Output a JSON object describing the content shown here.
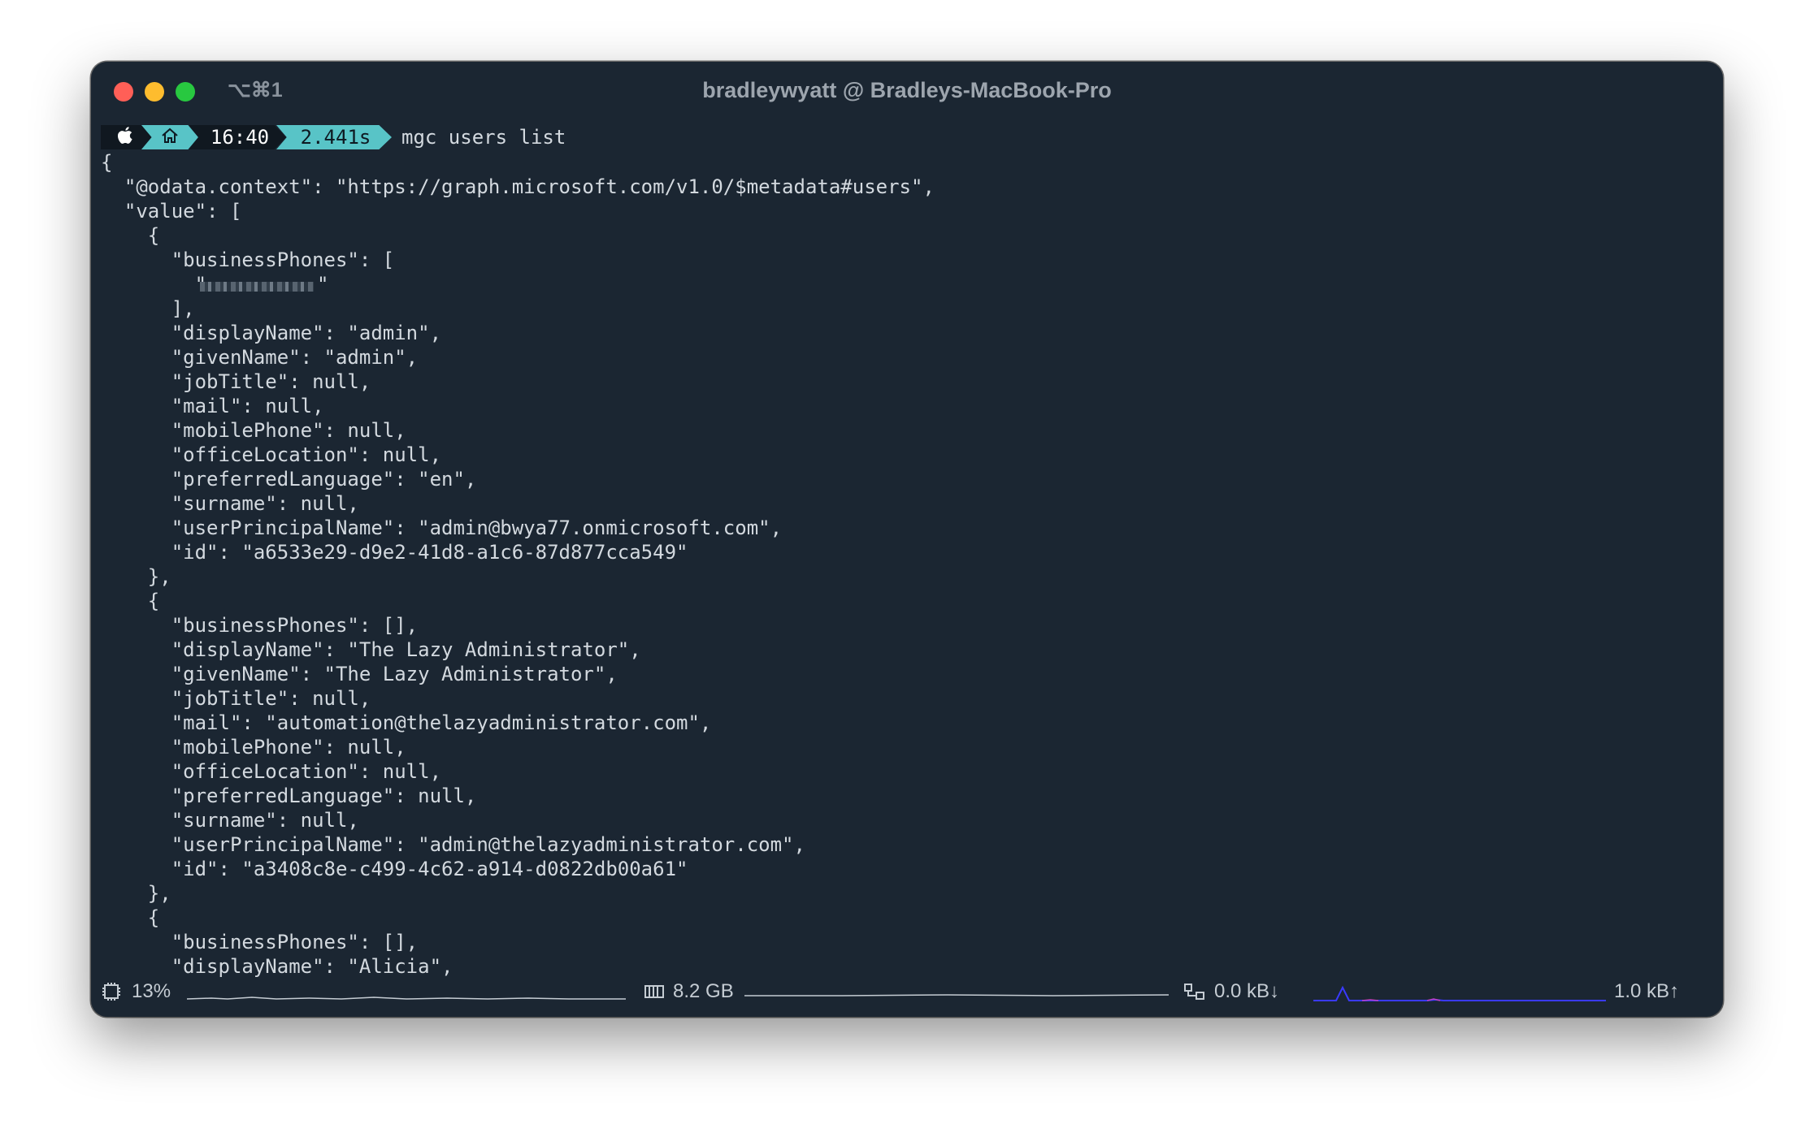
{
  "window": {
    "title": "bradleywyatt @ Bradleys-MacBook-Pro",
    "shortcut": "⌥⌘1",
    "traffic_lights": {
      "close_color": "#ff5f57",
      "minimize_color": "#febc2e",
      "zoom_color": "#28c840"
    }
  },
  "prompt": {
    "apple_icon": "apple-icon",
    "home_icon": "home-icon",
    "time": "16:40",
    "duration": "2.441s",
    "command": "mgc users list",
    "accent_color": "#58c4c7"
  },
  "output": {
    "lines": [
      "{",
      "  \"@odata.context\": \"https://graph.microsoft.com/v1.0/$metadata#users\",",
      "  \"value\": [",
      "    {",
      "      \"businessPhones\": [",
      "        \"",
      "      ],",
      "      \"displayName\": \"admin\",",
      "      \"givenName\": \"admin\",",
      "      \"jobTitle\": null,",
      "      \"mail\": null,",
      "      \"mobilePhone\": null,",
      "      \"officeLocation\": null,",
      "      \"preferredLanguage\": \"en\",",
      "      \"surname\": null,",
      "      \"userPrincipalName\": \"admin@bwya77.onmicrosoft.com\",",
      "      \"id\": \"a6533e29-d9e2-41d8-a1c6-87d877cca549\"",
      "    },",
      "    {",
      "      \"businessPhones\": [],",
      "      \"displayName\": \"The Lazy Administrator\",",
      "      \"givenName\": \"The Lazy Administrator\",",
      "      \"jobTitle\": null,",
      "      \"mail\": \"automation@thelazyadministrator.com\",",
      "      \"mobilePhone\": null,",
      "      \"officeLocation\": null,",
      "      \"preferredLanguage\": null,",
      "      \"surname\": null,",
      "      \"userPrincipalName\": \"admin@thelazyadministrator.com\",",
      "      \"id\": \"a3408c8e-c499-4c62-a914-d0822db00a61\"",
      "    },",
      "    {",
      "      \"businessPhones\": [],",
      "      \"displayName\": \"Alicia\","
    ]
  },
  "status_bar": {
    "cpu": {
      "icon": "cpu-icon",
      "value": "13%"
    },
    "memory": {
      "icon": "memory-icon",
      "value": "8.2 GB"
    },
    "network": {
      "icon": "network-icon",
      "download": "0.0 kB↓",
      "upload": "1.0 kB↑",
      "graph_color": "#3a3aff"
    }
  }
}
